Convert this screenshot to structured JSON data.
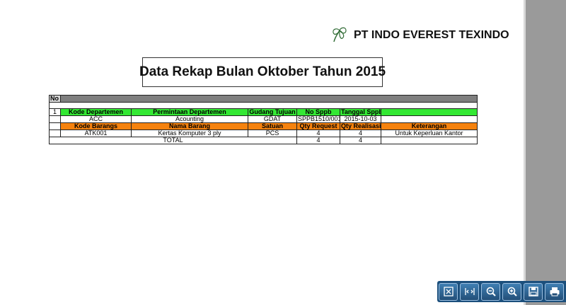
{
  "header": {
    "company_name": "PT INDO EVEREST TEXINDO",
    "logo_icon": "cotton-flower-icon"
  },
  "report": {
    "title": "Data Rekap Bulan Oktober Tahun 2015",
    "no_label": "No",
    "row_number": "1",
    "dept_headers": [
      "Kode Departemen",
      "Permintaan Departemen",
      "Gudang Tujuan",
      "No Sppb",
      "Tanggal Sppb"
    ],
    "dept_values": [
      "ACC",
      "Acounting",
      "GDAT",
      "SPPB1510/001",
      "2015-10-03"
    ],
    "item_headers": [
      "Kode Barangs",
      "Nama Barang",
      "Satuan",
      "Qty Request",
      "Qty Realisasi",
      "Keterangan"
    ],
    "item_values": [
      "ATK001",
      "Kertas Komputer 3 ply",
      "PCS",
      "4",
      "4",
      "Untuk Keperluan Kantor"
    ],
    "total_label": "TOTAL",
    "total_request": "4",
    "total_realisasi": "4",
    "colors": {
      "green": "#33e833",
      "orange": "#f5820e",
      "gray": "#7f7f7f"
    }
  },
  "toolbar": {
    "buttons": [
      "fit-page-icon",
      "fit-width-icon",
      "zoom-out-icon",
      "zoom-in-icon",
      "save-icon",
      "print-icon"
    ]
  }
}
